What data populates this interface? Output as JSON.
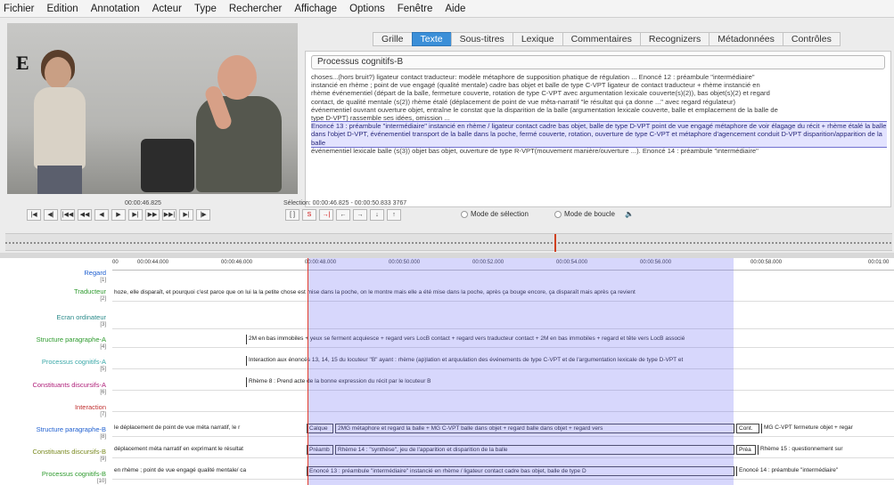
{
  "menu": [
    "Fichier",
    "Edition",
    "Annotation",
    "Acteur",
    "Type",
    "Rechercher",
    "Affichage",
    "Options",
    "Fenêtre",
    "Aide"
  ],
  "video": {
    "label": "E"
  },
  "tabs": [
    "Grille",
    "Texte",
    "Sous-titres",
    "Lexique",
    "Commentaires",
    "Recognizers",
    "Métadonnées",
    "Contrôles"
  ],
  "active_tab": "Texte",
  "text_panel": {
    "tier": "Processus cognitifs-B",
    "lines": [
      "choses...(hors bruit?) ligateur contact traducteur: modèle métaphore de supposition phatique de régulation ... Enoncé 12 : préambule \"intermédiaire\"",
      "instancié en rhème ; point de vue engagé (qualité mentale) cadre bas objet et balle de type C-VPT ligateur de contact traducteur + rhème instancié en",
      "rhème événementiel (départ de la balle, fermeture couverte, rotation de type C-VPT avec argumentation lexicale couverte(s)(2)), bas objet(s)(2) et regard",
      "contact, de qualité mentale (s(2)) rhème étalé (déplacement de point de vue mêta-narratif \"le résultat qui ça donne ...\" avec regard régulateur)",
      "événementiel ouvrant ouverture objet, entraîne le constat que la disparition de la balle (argumentation lexicale couverte, balle et emplacement de la balle de",
      "type D-VPT) rassemble ses idées, omission ..."
    ],
    "highlight": "Enoncé 13 : préambule \"intermédiaire\" instancié en rhème / ligateur contact cadre bas objet, balle de type D-VPT point de vue engagé métaphore de voir élagage du récit + rhème étalé la balle dans l'objet D-VPT, événementiel transport de la balle dans la poche, fermé couverte, rotation, ouverture de type C-VPT et métaphore d'agencement conduit D-VPT disparition/apparition de la balle",
    "tail": "événementiel lexicale balle (s(3)) objet bas objet, ouverture de type R-VPT(mouvement manière/ouverture ...). Enoncé 14 : préambule \"intermédiaire\""
  },
  "player": {
    "time": "00:00:46.825",
    "selection": "Sélection: 00:00:46.825 - 00:00:50.833  3767",
    "mode_selection": "Mode de sélection",
    "mode_loop": "Mode de boucle",
    "controls": [
      "|◀",
      "◀|",
      "|◀◀",
      "◀◀",
      "◀",
      "▶",
      "▶|",
      "▶▶",
      "▶▶|",
      "▶|",
      "|▶"
    ],
    "controls2": [
      "[ ]",
      "S",
      "→|",
      "←",
      "→",
      "↓",
      "↑"
    ]
  },
  "timeline": {
    "ticks": [
      "00",
      "00:00:44.000",
      "00:00:46.000",
      "00:00:48.000",
      "00:00:50.000",
      "00:00:52.000",
      "00:00:54.000",
      "00:00:56.000",
      "00:00:58.000",
      "00:01:00"
    ]
  },
  "tiers": [
    {
      "name": "Regard",
      "count": "[1]",
      "color": "#2060d0"
    },
    {
      "name": "Traducteur",
      "count": "[2]",
      "color": "#2d9a2d"
    },
    {
      "name": "Ecran ordinateur",
      "count": "[3]",
      "color": "#2a8a8a"
    },
    {
      "name": "Structure paragraphe-A",
      "count": "[4]",
      "color": "#2d9a2d"
    },
    {
      "name": "Processus cognitifs-A",
      "count": "[5]",
      "color": "#3aa8a8"
    },
    {
      "name": "Constituants discursifs-A",
      "count": "[6]",
      "color": "#b0207a"
    },
    {
      "name": "Interaction",
      "count": "[7]",
      "color": "#c03030"
    },
    {
      "name": "Structure paragraphe-B",
      "count": "[8]",
      "color": "#2060d0"
    },
    {
      "name": "Constituants discursifs-B",
      "count": "[9]",
      "color": "#7a8a20"
    },
    {
      "name": "Processus cognitifs-B",
      "count": "[10]",
      "color": "#2d9a2d"
    }
  ],
  "annotations": {
    "traducteur": "hoze, elle disparaît, et pourquoi c'est parce que on lui la la petite chose est mise dans la poche, on le montre mais elle a été mise dans la poche, après ça bouge encore, ça disparaît mais après ça revient",
    "struct_a": "2M en bas immobiles + yeux se ferment acquiesce + regard vers LocB contact + regard vers traducteur contact + 2M en bas immobiles + regard et tête vers LocB associé",
    "proc_a": "Interaction aux énoncés 13, 14, 15 du locuteur \"B\" ayant : rhème (ap)lation et arquulation des événements de type C-VPT et de l'argumentation lexicale de type D-VPT et",
    "const_a": "Rhème 8 : Prend acte de la bonne expression du récit par le locuteur B",
    "struct_b_1": "le déplacement de point de vue méta narratif, le r",
    "struct_b_2": "Calque",
    "struct_b_3": "2MG métaphore et regard la balle + MG C-VPT balle dans objet + regard balle dans objet + regard vers",
    "struct_b_4": "Cont.",
    "struct_b_5": "MG C-VPT fermeture objet + regar",
    "const_b_1": "déplacement méta narratif en exprimant le résultat",
    "const_b_2": "Préamb",
    "const_b_3": "Rhème 14 : \"synthèse\", jeu de l'apparition et disparition de la balle",
    "const_b_4": "Préa",
    "const_b_5": "Rhème 15 : questionnement sur",
    "proc_b_1": "en rhème ; point de vue engagé qualité mentale/ ca",
    "proc_b_2": "Enoncé 13 : préambule \"intermédiaire\" instancié en rhème / ligateur contact cadre bas objet, balle de type D",
    "proc_b_3": "Enoncé 14 : préambule \"intermédiaire\""
  }
}
